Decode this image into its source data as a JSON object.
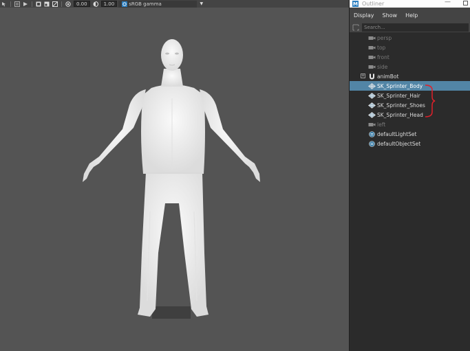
{
  "viewport": {
    "toolbar": {
      "exposure_value": "0.00",
      "gamma_value": "1.00",
      "color_space": "sRGB gamma",
      "icons": [
        "select-arrow-icon",
        "layout-icon",
        "camera-attributes-icon",
        "resolution-gate-icon",
        "exposure-icon",
        "gamma-icon",
        "color-management-icon",
        "dropdown-arrow-icon"
      ]
    }
  },
  "outliner": {
    "title": "Outliner",
    "logo_letter": "M",
    "menu": [
      "Display",
      "Show",
      "Help"
    ],
    "search_placeholder": "Search...",
    "items": [
      {
        "label": "persp",
        "icon": "camera-icon",
        "state": "dim"
      },
      {
        "label": "top",
        "icon": "camera-icon",
        "state": "dim"
      },
      {
        "label": "front",
        "icon": "camera-icon",
        "state": "dim"
      },
      {
        "label": "side",
        "icon": "camera-icon",
        "state": "dim"
      },
      {
        "label": "animBot",
        "icon": "magnet-icon",
        "state": "normal",
        "expandable": true
      },
      {
        "label": "SK_Sprinter_Body",
        "icon": "mesh-icon",
        "state": "selected"
      },
      {
        "label": "SK_Sprinter_Hair",
        "icon": "mesh-icon",
        "state": "normal"
      },
      {
        "label": "SK_Sprinter_Shoes",
        "icon": "mesh-icon",
        "state": "normal"
      },
      {
        "label": "SK_Sprinter_Head",
        "icon": "mesh-icon",
        "state": "normal"
      },
      {
        "label": "left",
        "icon": "camera-icon",
        "state": "dim"
      },
      {
        "label": "defaultLightSet",
        "icon": "set-icon",
        "state": "normal"
      },
      {
        "label": "defaultObjectSet",
        "icon": "set-icon",
        "state": "normal"
      }
    ],
    "expand_symbol": "+"
  },
  "colors": {
    "viewport_bg": "#545454",
    "outliner_bg": "#2b2b2b",
    "selection": "#5285a6",
    "annotation": "#e0202a",
    "figure": "#f2f2f2"
  }
}
